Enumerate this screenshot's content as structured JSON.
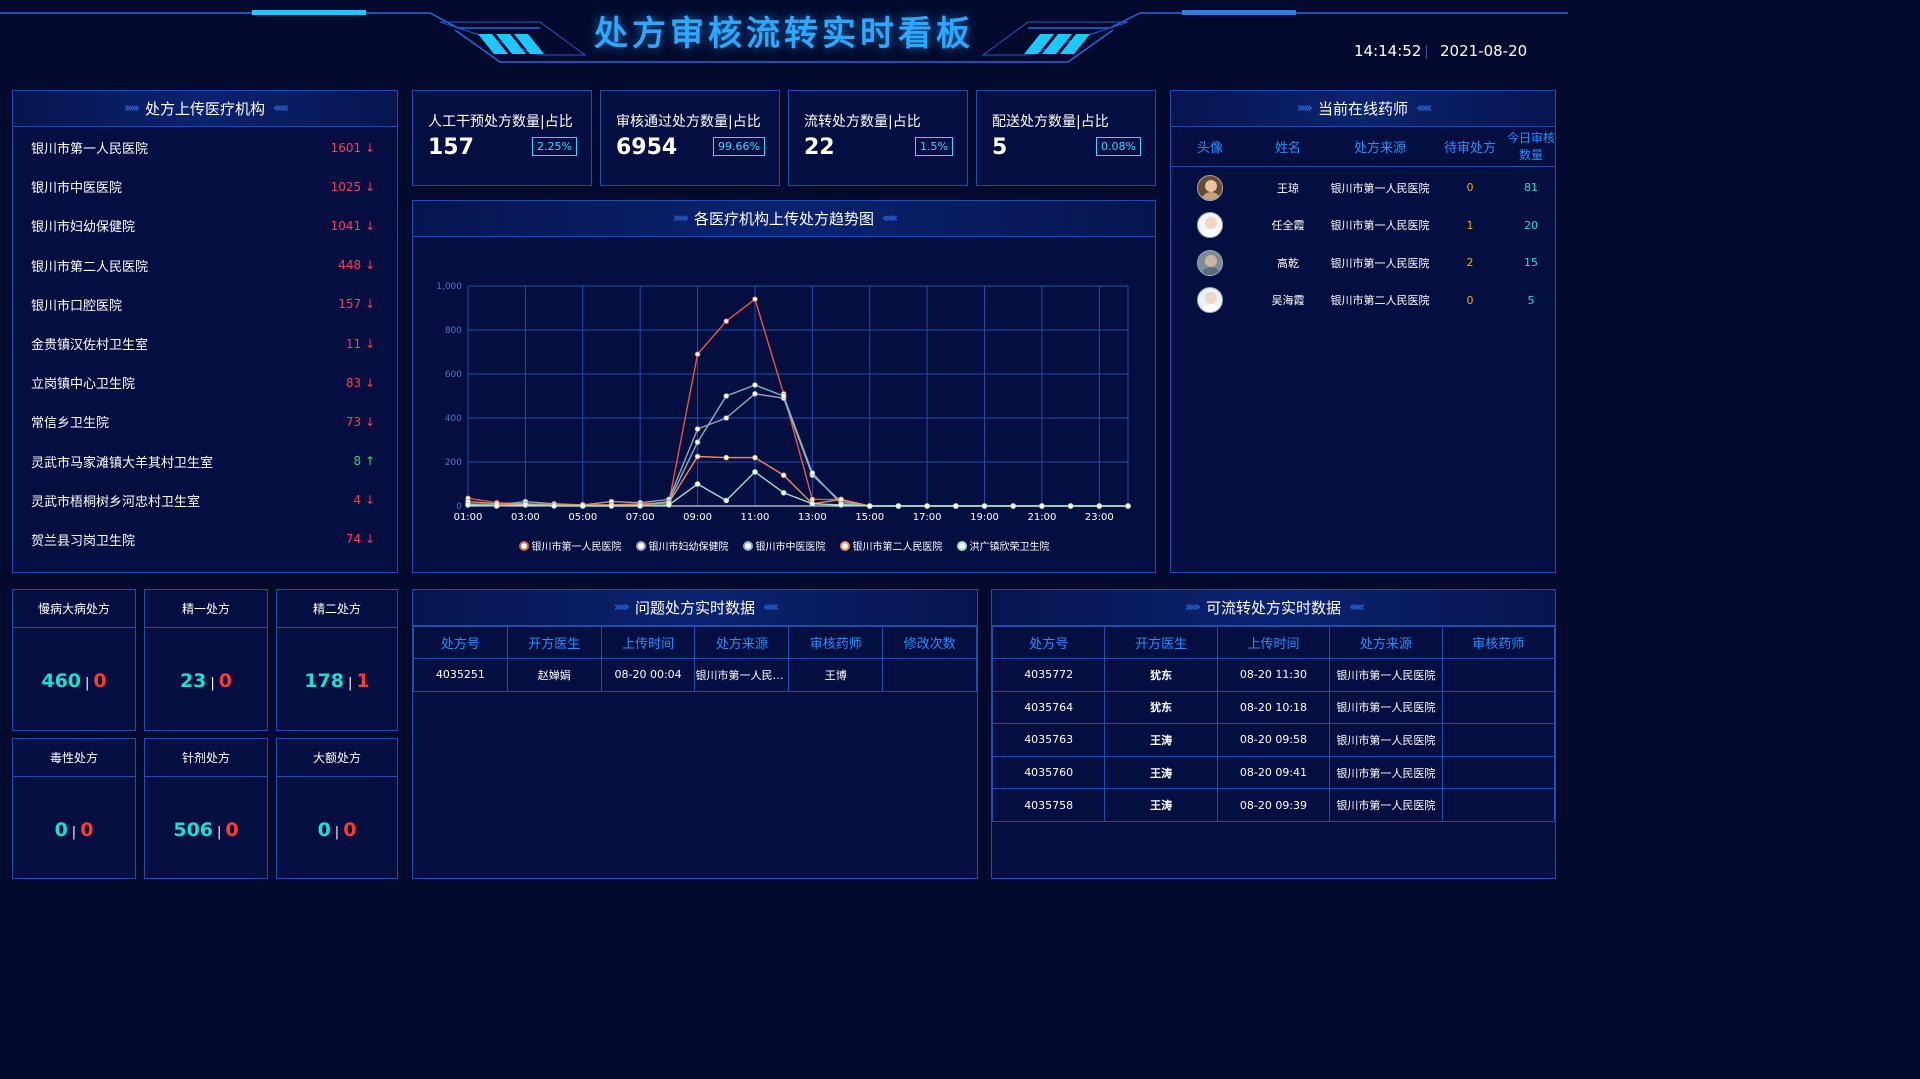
{
  "header": {
    "title": "处方审核流转实时看板",
    "time": "14:14:52",
    "date": "2021-08-20"
  },
  "institutions": {
    "title": "处方上传医疗机构",
    "items": [
      {
        "name": "银川市第一人民医院",
        "value": "1601",
        "trend": "down"
      },
      {
        "name": "银川市中医医院",
        "value": "1025",
        "trend": "down"
      },
      {
        "name": "银川市妇幼保健院",
        "value": "1041",
        "trend": "down"
      },
      {
        "name": "银川市第二人民医院",
        "value": "448",
        "trend": "down"
      },
      {
        "name": "银川市口腔医院",
        "value": "157",
        "trend": "down"
      },
      {
        "name": "金贵镇汉佐村卫生室",
        "value": "11",
        "trend": "down"
      },
      {
        "name": "立岗镇中心卫生院",
        "value": "83",
        "trend": "down"
      },
      {
        "name": "常信乡卫生院",
        "value": "73",
        "trend": "down"
      },
      {
        "name": "灵武市马家滩镇大羊其村卫生室",
        "value": "8",
        "trend": "up"
      },
      {
        "name": "灵武市梧桐树乡河忠村卫生室",
        "value": "4",
        "trend": "down"
      },
      {
        "name": "贺兰县习岗卫生院",
        "value": "74",
        "trend": "down"
      }
    ],
    "arrow_down": "↓",
    "arrow_up": "↑"
  },
  "stats": [
    {
      "label": "人工干预处方数量|占比",
      "value": "157",
      "pct": "2.25%"
    },
    {
      "label": "审核通过处方数量|占比",
      "value": "6954",
      "pct": "99.66%"
    },
    {
      "label": "流转处方数量|占比",
      "value": "22",
      "pct": "1.5%"
    },
    {
      "label": "配送处方数量|占比",
      "value": "5",
      "pct": "0.08%"
    }
  ],
  "trend": {
    "title": "各医疗机构上传处方趋势图"
  },
  "chart_data": {
    "type": "line",
    "title": "各医疗机构上传处方趋势图",
    "x": [
      "01:00",
      "02:00",
      "03:00",
      "04:00",
      "05:00",
      "06:00",
      "07:00",
      "08:00",
      "09:00",
      "10:00",
      "11:00",
      "12:00",
      "13:00",
      "14:00",
      "15:00",
      "16:00",
      "17:00",
      "18:00",
      "19:00",
      "20:00",
      "21:00",
      "22:00",
      "23:00",
      "24:00"
    ],
    "xticks": [
      "01:00",
      "03:00",
      "05:00",
      "07:00",
      "09:00",
      "11:00",
      "13:00",
      "15:00",
      "17:00",
      "19:00",
      "21:00",
      "23:00"
    ],
    "ylim": [
      0,
      1000
    ],
    "yticks": [
      "0",
      "200",
      "400",
      "600",
      "800",
      "1,000"
    ],
    "grid": true,
    "legend": "bottom",
    "series": [
      {
        "name": "银川市第一人民医院",
        "color": "#e8573d",
        "values": [
          35,
          15,
          10,
          5,
          5,
          5,
          10,
          15,
          690,
          840,
          940,
          510,
          30,
          30,
          0,
          0,
          0,
          0,
          0,
          0,
          0,
          0,
          0,
          0
        ]
      },
      {
        "name": "银川市妇幼保健院",
        "color": "#9ca3b5",
        "values": [
          10,
          5,
          20,
          10,
          5,
          20,
          15,
          30,
          350,
          400,
          510,
          490,
          140,
          20,
          0,
          0,
          0,
          0,
          0,
          0,
          0,
          0,
          0,
          0
        ]
      },
      {
        "name": "银川市中医医院",
        "color": "#7fb3c8",
        "values": [
          5,
          5,
          10,
          5,
          0,
          5,
          5,
          20,
          290,
          500,
          550,
          500,
          150,
          10,
          0,
          0,
          0,
          0,
          0,
          0,
          0,
          0,
          0,
          0
        ]
      },
      {
        "name": "银川市第二人民医院",
        "color": "#f08c5a",
        "values": [
          20,
          10,
          5,
          5,
          5,
          5,
          5,
          15,
          225,
          220,
          220,
          140,
          10,
          30,
          0,
          0,
          0,
          0,
          0,
          0,
          0,
          0,
          0,
          0
        ]
      },
      {
        "name": "洪广镇欣荣卫生院",
        "color": "#9ce0c8",
        "values": [
          5,
          0,
          5,
          0,
          0,
          0,
          0,
          5,
          100,
          25,
          155,
          60,
          10,
          5,
          0,
          0,
          0,
          0,
          0,
          0,
          0,
          0,
          0,
          0
        ]
      }
    ]
  },
  "pharmacists": {
    "title": "当前在线药师",
    "headers": [
      "头像",
      "姓名",
      "处方来源",
      "待审处方",
      "今日审核数量"
    ],
    "rows": [
      {
        "name": "王琼",
        "source": "银川市第一人民医院",
        "pending": "0",
        "today": "81",
        "avatar": "female-avatar-icon"
      },
      {
        "name": "任全霞",
        "source": "银川市第一人民医院",
        "pending": "1",
        "today": "20",
        "avatar": "doctor-avatar-icon"
      },
      {
        "name": "高乾",
        "source": "银川市第一人民医院",
        "pending": "2",
        "today": "15",
        "avatar": "male-avatar-icon"
      },
      {
        "name": "吴海霞",
        "source": "银川市第二人民医院",
        "pending": "0",
        "today": "5",
        "avatar": "nurse-avatar-icon"
      }
    ]
  },
  "categories": [
    {
      "label": "慢病大病处方",
      "a": "460",
      "b": "0"
    },
    {
      "label": "精一处方",
      "a": "23",
      "b": "0"
    },
    {
      "label": "精二处方",
      "a": "178",
      "b": "1"
    },
    {
      "label": "毒性处方",
      "a": "0",
      "b": "0"
    },
    {
      "label": "针剂处方",
      "a": "506",
      "b": "0"
    },
    {
      "label": "大额处方",
      "a": "0",
      "b": "0"
    }
  ],
  "problem": {
    "title": "问题处方实时数据",
    "headers": [
      "处方号",
      "开方医生",
      "上传时间",
      "处方来源",
      "审核药师",
      "修改次数"
    ],
    "rows": [
      [
        "4035251",
        "赵婵娟",
        "08-20 00:04",
        "银川市第一人民医院",
        "王博",
        ""
      ]
    ]
  },
  "transfer": {
    "title": "可流转处方实时数据",
    "headers": [
      "处方号",
      "开方医生",
      "上传时间",
      "处方来源",
      "审核药师"
    ],
    "rows": [
      [
        "4035772",
        "犹东",
        "08-20 11:30",
        "银川市第一人民医院",
        ""
      ],
      [
        "4035764",
        "犹东",
        "08-20 10:18",
        "银川市第一人民医院",
        ""
      ],
      [
        "4035763",
        "王涛",
        "08-20 09:58",
        "银川市第一人民医院",
        ""
      ],
      [
        "4035760",
        "王涛",
        "08-20 09:41",
        "银川市第一人民医院",
        ""
      ],
      [
        "4035758",
        "王涛",
        "08-20 09:39",
        "银川市第一人民医院",
        ""
      ]
    ]
  }
}
